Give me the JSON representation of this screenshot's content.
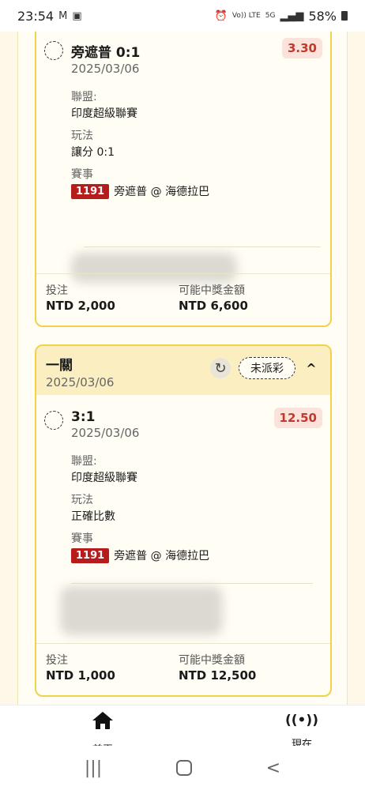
{
  "status_bar": {
    "time": "23:54",
    "left_icons": [
      "gmail-icon",
      "image-icon"
    ],
    "signal_text_1": "Vo)) LTE",
    "signal_text_2": "5G",
    "battery": "58%"
  },
  "cards": [
    {
      "selection": {
        "title": "旁遮普 0:1",
        "date": "2025/03/06",
        "odds": "3.30",
        "league_label": "聯盟:",
        "league": "印度超級聯賽",
        "market_label": "玩法",
        "market": "讓分 0:1",
        "event_label": "賽事",
        "match_id": "1191",
        "match": "旁遮普 @ 海德拉巴"
      },
      "footer": {
        "stake_label": "投注",
        "stake": "NTD 2,000",
        "payout_label": "可能中獎金額",
        "payout": "NTD 6,600"
      }
    },
    {
      "header": {
        "title": "一關",
        "date": "2025/03/06",
        "status": "未派彩"
      },
      "selection": {
        "title": "3:1",
        "date": "2025/03/06",
        "odds": "12.50",
        "league_label": "聯盟:",
        "league": "印度超級聯賽",
        "market_label": "玩法",
        "market": "正確比數",
        "event_label": "賽事",
        "match_id": "1191",
        "match": "旁遮普 @ 海德拉巴"
      },
      "footer": {
        "stake_label": "投注",
        "stake": "NTD 1,000",
        "payout_label": "可能中獎金額",
        "payout": "NTD 12,500"
      }
    }
  ],
  "bottom_nav": {
    "home_label": "首頁",
    "live_label": "現在"
  },
  "colors": {
    "accent_border": "#f2d24a",
    "odds_text": "#c0392b",
    "match_id_bg": "#b71c1c"
  }
}
